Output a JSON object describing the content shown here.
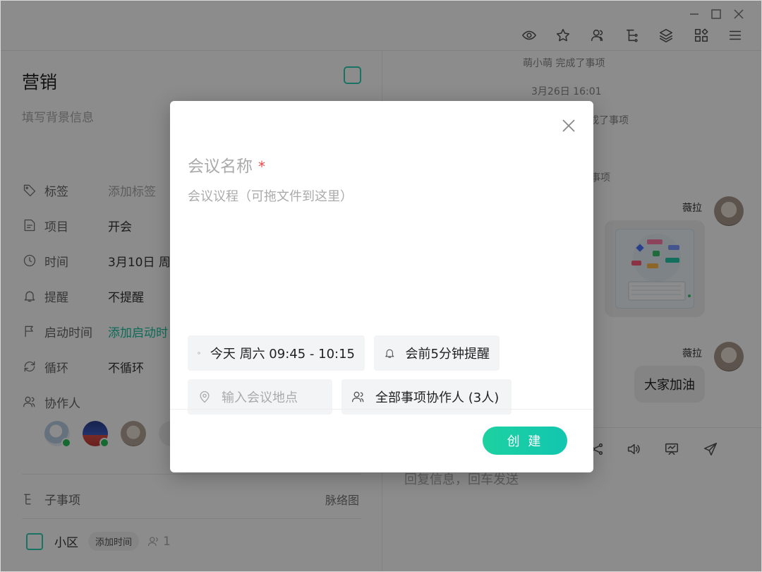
{
  "window": {
    "controls": [
      "minimize-icon",
      "maximize-icon",
      "close-icon"
    ],
    "toolbar_icons": [
      "eye-icon",
      "star-icon",
      "members-icon",
      "tree-icon",
      "layers-icon",
      "apps-icon",
      "menu-icon"
    ]
  },
  "task": {
    "title": "营销",
    "background_placeholder": "填写背景信息",
    "fields": {
      "tag": {
        "label": "标签",
        "value": "添加标签"
      },
      "project": {
        "label": "项目",
        "value": "开会"
      },
      "time": {
        "label": "时间",
        "value": "3月10日 周"
      },
      "reminder": {
        "label": "提醒",
        "value": "不提醒"
      },
      "start_time": {
        "label": "启动时间",
        "value": "添加启动时"
      },
      "repeat": {
        "label": "循环",
        "value": "不循环"
      },
      "collaborators": {
        "label": "协作人"
      }
    },
    "subtasks": {
      "label": "子事项",
      "map_link": "脉络图",
      "items": [
        {
          "name": "小区",
          "time_chip": "添加时间",
          "count": "1"
        }
      ]
    }
  },
  "activity": {
    "messages": {
      "sys1": "萌小萌 完成了事项",
      "time1": "3月26日 16:01",
      "sys2_fragment": "成了事项",
      "sys3_fragment": "事项",
      "user_a": "薇拉",
      "user_b": "薇拉",
      "text_bubble": "大家加油"
    },
    "reply_placeholder": "回复信息，回车发送",
    "input_icons": [
      "share-icon",
      "voice-icon",
      "whiteboard-icon",
      "send-icon"
    ]
  },
  "modal": {
    "name_placeholder": "会议名称",
    "required_mark": "*",
    "agenda_placeholder": "会议议程（可拖文件到这里）",
    "time_chip": "今天 周六 09:45 - 10:15",
    "reminder_chip": "会前5分钟提醒",
    "location_placeholder": "输入会议地点",
    "participants_chip": "全部事项协作人 (3人)",
    "create_button": "创 建"
  },
  "colors": {
    "accent": "#19c4a3",
    "required": "#f04848",
    "overlay": "rgba(0,0,0,0.45)"
  }
}
